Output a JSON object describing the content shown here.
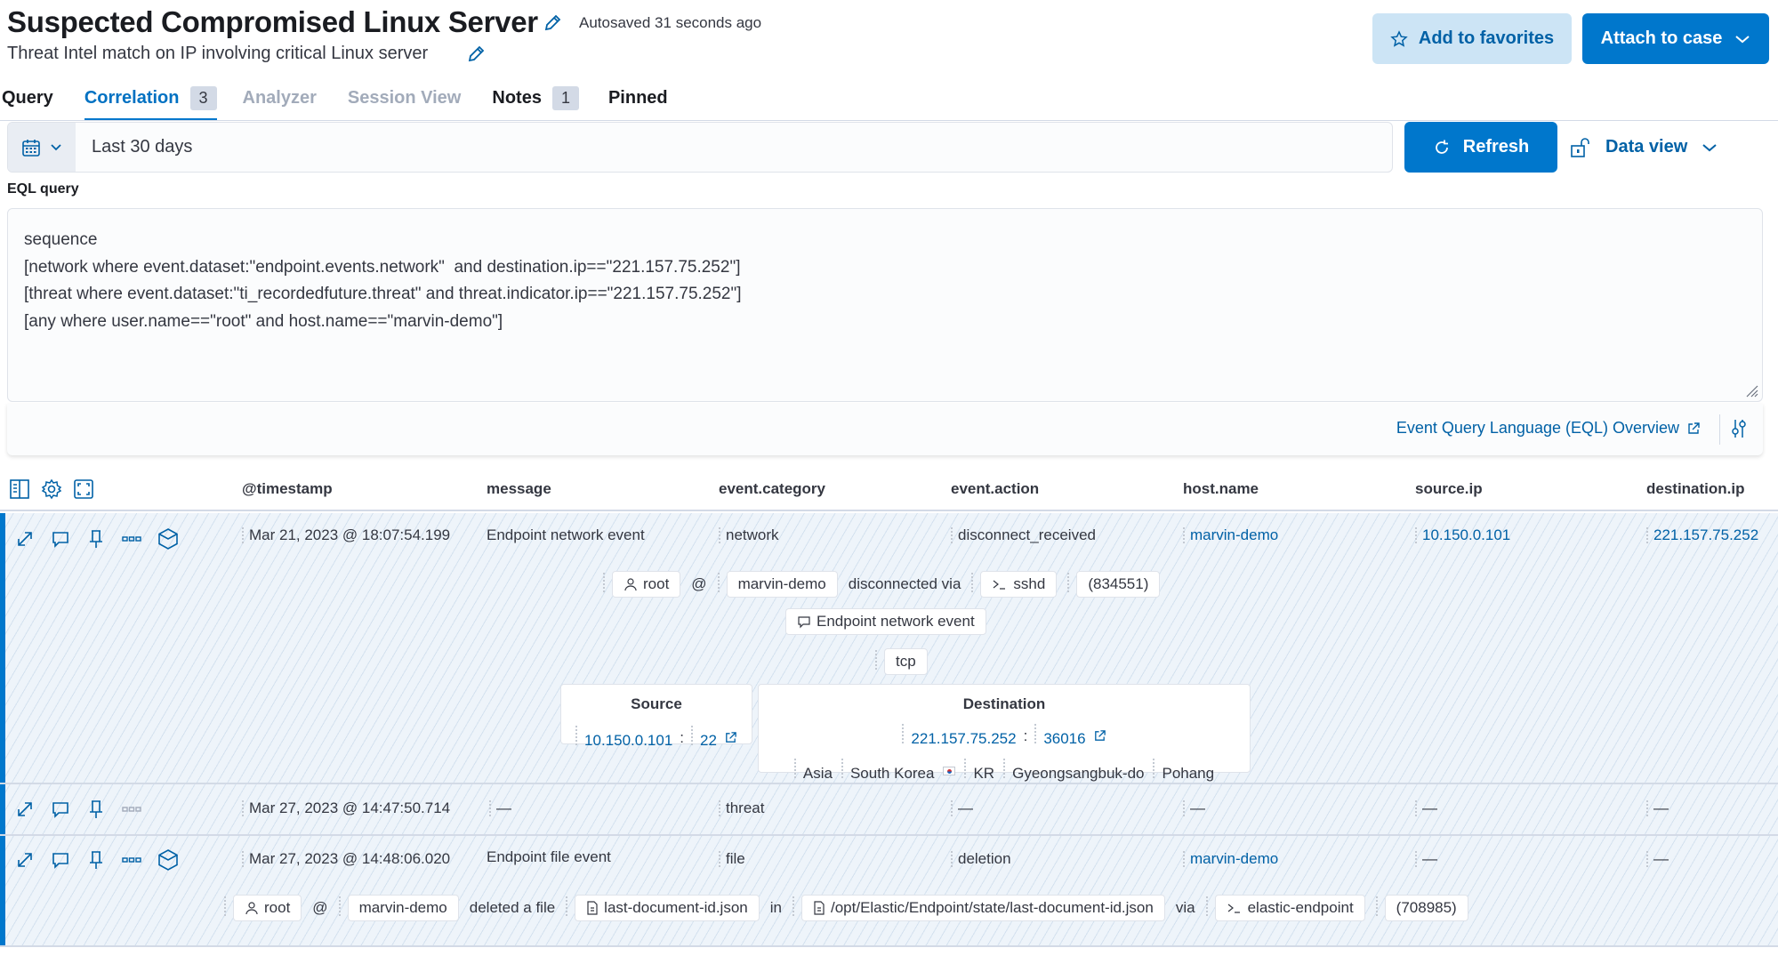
{
  "header": {
    "title": "Suspected Compromised Linux Server",
    "autosaved": "Autosaved 31 seconds ago",
    "subtitle": "Threat Intel match on IP involving critical Linux server",
    "favorites_label": "Add to favorites",
    "attach_label": "Attach to case"
  },
  "tabs": [
    {
      "label": "Query",
      "state": "normal"
    },
    {
      "label": "Correlation",
      "badge": "3",
      "state": "active"
    },
    {
      "label": "Analyzer",
      "state": "disabled"
    },
    {
      "label": "Session View",
      "state": "disabled"
    },
    {
      "label": "Notes",
      "badge": "1",
      "state": "normal"
    },
    {
      "label": "Pinned",
      "state": "normal"
    }
  ],
  "search": {
    "date_range": "Last 30 days",
    "refresh_label": "Refresh",
    "data_view_label": "Data view"
  },
  "eql": {
    "label": "EQL query",
    "lines": [
      "sequence",
      "[network where event.dataset:\"endpoint.events.network\"  and destination.ip==\"221.157.75.252\"]",
      "[threat where event.dataset:\"ti_recordedfuture.threat\" and threat.indicator.ip==\"221.157.75.252\"]",
      "[any where user.name==\"root\" and host.name==\"marvin-demo\"]"
    ],
    "doc_link": "Event Query Language (EQL) Overview"
  },
  "grid": {
    "columns": [
      "@timestamp",
      "message",
      "event.category",
      "event.action",
      "host.name",
      "source.ip",
      "destination.ip"
    ],
    "rows": [
      {
        "timestamp": "Mar 21, 2023 @ 18:07:54.199",
        "message": "Endpoint network event",
        "category": "network",
        "action": "disconnect_received",
        "host": "marvin-demo",
        "source_ip": "10.150.0.101",
        "destination_ip": "221.157.75.252",
        "renderer": {
          "user": "root",
          "at": "@",
          "host": "marvin-demo",
          "verb": "disconnected via",
          "process": "sshd",
          "pid": "(834551)",
          "message": "Endpoint network event",
          "transport": "tcp",
          "source": {
            "header": "Source",
            "ip": "10.150.0.101",
            "sep": ":",
            "port": "22"
          },
          "destination": {
            "header": "Destination",
            "ip": "221.157.75.252",
            "sep": ":",
            "port": "36016",
            "continent": "Asia",
            "country": "South Korea",
            "country_code": "KR",
            "region": "Gyeongsangbuk-do",
            "city": "Pohang"
          }
        }
      },
      {
        "timestamp": "Mar 27, 2023 @ 14:47:50.714",
        "message": "—",
        "category": "threat",
        "action": "—",
        "host": "—",
        "source_ip": "—",
        "destination_ip": "—"
      },
      {
        "timestamp": "Mar 27, 2023 @ 14:48:06.020",
        "message": "Endpoint file event",
        "category": "file",
        "action": "deletion",
        "host": "marvin-demo",
        "source_ip": "—",
        "destination_ip": "—",
        "renderer": {
          "user": "root",
          "at": "@",
          "host": "marvin-demo",
          "verb": "deleted a file",
          "file": "last-document-id.json",
          "in": "in",
          "path": "/opt/Elastic/Endpoint/state/last-document-id.json",
          "via": "via",
          "process": "elastic-endpoint",
          "pid": "(708985)"
        }
      }
    ]
  },
  "colors": {
    "accent": "#0077cc",
    "link": "#0061a6",
    "fav_bg": "#cce4f5"
  }
}
